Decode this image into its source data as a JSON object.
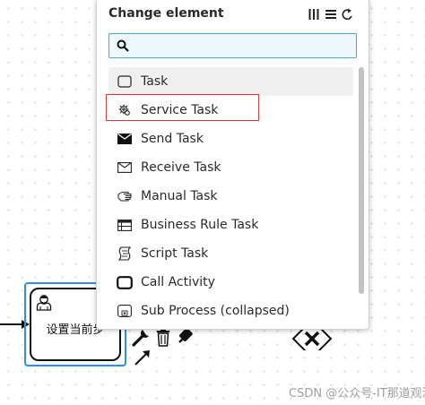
{
  "popup": {
    "title": "Change element",
    "search_placeholder": "",
    "entries": [
      {
        "label": "Task",
        "icon": "task-icon",
        "active": true
      },
      {
        "label": "Service Task",
        "icon": "gear-icon",
        "highlighted": true
      },
      {
        "label": "Send Task",
        "icon": "envelope-filled-icon"
      },
      {
        "label": "Receive Task",
        "icon": "envelope-outline-icon"
      },
      {
        "label": "Manual Task",
        "icon": "hand-icon"
      },
      {
        "label": "Business Rule Task",
        "icon": "table-icon"
      },
      {
        "label": "Script Task",
        "icon": "script-icon"
      },
      {
        "label": "Call Activity",
        "icon": "call-activity-icon"
      },
      {
        "label": "Sub Process (collapsed)",
        "icon": "subprocess-icon"
      }
    ]
  },
  "canvas": {
    "task_label": "设置当前步",
    "watermark": "CSDN @公众号-IT那道观测网"
  },
  "colors": {
    "selection": "#2d8ee6",
    "search_border": "#4aa8d8",
    "highlight": "#e13a3a"
  }
}
